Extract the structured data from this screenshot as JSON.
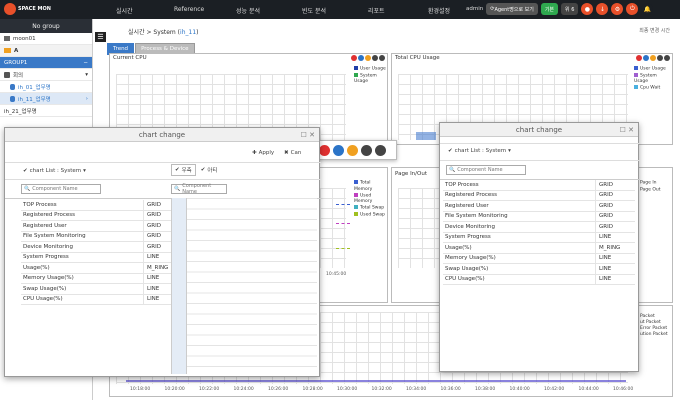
{
  "topbar": {
    "logo": "SPACE MON",
    "nav": [
      "실시간",
      "Reference",
      "성능 분석",
      "빈도 분석",
      "리포트",
      "환경설정"
    ],
    "user": "admin",
    "agent_button": "Agent명으로 보기",
    "green_button": "기본",
    "count_button": "위 6",
    "colors": {
      "bg": "#1b1f24",
      "accent": "#e8502a"
    }
  },
  "sidebar": {
    "header": "No group",
    "items": [
      {
        "label": "moon01",
        "icon": "server-icon"
      },
      {
        "label": "A",
        "icon": "folder-icon"
      },
      {
        "label": "GROUP1",
        "icon": "group-header"
      },
      {
        "label": "회의",
        "icon": "server-icon"
      },
      {
        "label": "ih_01_업무명",
        "icon": "db-icon"
      },
      {
        "label": "ih_11_업무명",
        "icon": "db-icon"
      },
      {
        "label": "ih_21_업무명",
        "icon": "db-icon"
      }
    ]
  },
  "main": {
    "breadcrumb_prefix": "실시간 > System (",
    "breadcrumb_hl": "ih_11",
    "breadcrumb_suffix": ")",
    "update_label": "최종 변경 시간",
    "tabs": [
      "Trend",
      "Process & Device"
    ],
    "panels": {
      "current_cpu": {
        "title": "Current CPU",
        "legend": [
          "User Usage",
          "System Usage"
        ]
      },
      "total_cpu": {
        "title": "Total CPU Usage",
        "legend": [
          "User Usage",
          "System Usage",
          "Cpu Wait"
        ]
      },
      "memory": {
        "legend": [
          "Total Memory",
          "Used Memory",
          "Total Swap",
          "Used Swap"
        ],
        "time": "10:45:00"
      },
      "page_inout": {
        "title": "Page In/Out",
        "legend": [
          "Page In",
          "Page Out"
        ]
      },
      "network": {
        "legend": [
          "Packet",
          "ut Packet",
          "Error Packet",
          "ution Packet"
        ]
      }
    },
    "x_ticks": [
      "10:18:00",
      "10:20:00",
      "10:22:00",
      "10:24:00",
      "10:26:00",
      "10:28:00",
      "10:30:00",
      "10:32:00",
      "10:34:00",
      "10:36:00",
      "10:38:00",
      "10:40:00",
      "10:42:00",
      "10:44:00",
      "10:46:00"
    ]
  },
  "dialog1": {
    "title": "chart change",
    "apply": "Apply",
    "cancel": "Can",
    "list_label": "chart List : System",
    "search_placeholder": "Component Name",
    "add_btn": "우측",
    "remove_btn": "아티",
    "rows": [
      {
        "name": "TOP Process",
        "type": "GRID"
      },
      {
        "name": "Registered Process",
        "type": "GRID"
      },
      {
        "name": "Registered User",
        "type": "GRID"
      },
      {
        "name": "File System Monitoring",
        "type": "GRID"
      },
      {
        "name": "Device Monitoring",
        "type": "GRID"
      },
      {
        "name": "System Progress",
        "type": "LINE"
      },
      {
        "name": "Usage(%)",
        "type": "M_RING"
      },
      {
        "name": "Memory Usage(%)",
        "type": "LINE"
      },
      {
        "name": "Swap Usage(%)",
        "type": "LINE"
      },
      {
        "name": "CPU Usage(%)",
        "type": "LINE"
      }
    ]
  },
  "dialog2": {
    "title": "chart change",
    "list_label": "chart List : System",
    "search_placeholder": "Component Name",
    "rows": [
      {
        "name": "TOP Process",
        "type": "GRID"
      },
      {
        "name": "Registered Process",
        "type": "GRID"
      },
      {
        "name": "Registered User",
        "type": "GRID"
      },
      {
        "name": "File System Monitoring",
        "type": "GRID"
      },
      {
        "name": "Device Monitoring",
        "type": "GRID"
      },
      {
        "name": "System Progress",
        "type": "LINE"
      },
      {
        "name": "Usage(%)",
        "type": "M_RING"
      },
      {
        "name": "Memory Usage(%)",
        "type": "LINE"
      },
      {
        "name": "Swap Usage(%)",
        "type": "LINE"
      },
      {
        "name": "CPU Usage(%)",
        "type": "LINE"
      }
    ]
  }
}
